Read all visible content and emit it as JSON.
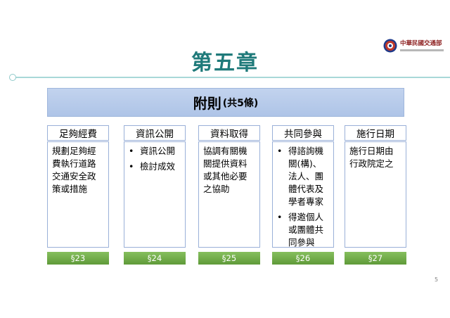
{
  "slide": {
    "title": "第五章",
    "page_number": "5",
    "logo_name": "中華民國交通部"
  },
  "header": {
    "main": "附則",
    "sub": "(共5條)"
  },
  "columns": [
    {
      "heading": "足夠經費",
      "text": "規劃足夠經費執行道路交通安全政策或措施",
      "article": "§23"
    },
    {
      "heading": "資訊公開",
      "items": [
        "資訊公開",
        "檢討成效"
      ],
      "article": "§24"
    },
    {
      "heading": "資料取得",
      "text": "協調有關機關提供資料或其他必要之協助",
      "article": "§25"
    },
    {
      "heading": "共同參與",
      "items": [
        "得諮詢機關(構)、法人、團體代表及學者專家",
        "得邀個人或團體共同參與"
      ],
      "article": "§26"
    },
    {
      "heading": "施行日期",
      "text": "施行日期由行政院定之",
      "article": "§27"
    }
  ],
  "colors": {
    "title": "#1f7a7a",
    "header_band": "#b8cbea",
    "box_border": "#9ab0d8",
    "tag_green": "#6fab48"
  }
}
